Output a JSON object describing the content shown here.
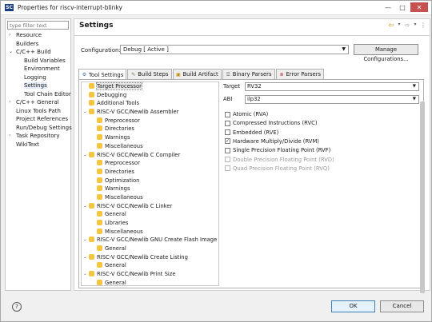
{
  "window": {
    "title": "Properties for riscv-interrupt-blinky",
    "app_icon_text": "SC"
  },
  "filter_placeholder": "type filter text",
  "nav_tree": [
    {
      "label": "Resource",
      "level": 0,
      "toggle": "›"
    },
    {
      "label": "Builders",
      "level": 0,
      "toggle": ""
    },
    {
      "label": "C/C++ Build",
      "level": 0,
      "toggle": "⌄"
    },
    {
      "label": "Build Variables",
      "level": 1,
      "toggle": ""
    },
    {
      "label": "Environment",
      "level": 1,
      "toggle": ""
    },
    {
      "label": "Logging",
      "level": 1,
      "toggle": ""
    },
    {
      "label": "Settings",
      "level": 1,
      "toggle": "",
      "selected": true
    },
    {
      "label": "Tool Chain Editor",
      "level": 1,
      "toggle": ""
    },
    {
      "label": "C/C++ General",
      "level": 0,
      "toggle": "›"
    },
    {
      "label": "Linux Tools Path",
      "level": 0,
      "toggle": ""
    },
    {
      "label": "Project References",
      "level": 0,
      "toggle": ""
    },
    {
      "label": "Run/Debug Settings",
      "level": 0,
      "toggle": ""
    },
    {
      "label": "Task Repository",
      "level": 0,
      "toggle": "›"
    },
    {
      "label": "WikiText",
      "level": 0,
      "toggle": ""
    }
  ],
  "page": {
    "title": "Settings",
    "configuration_label": "Configuration:",
    "configuration_value": "Debug  [ Active ]",
    "manage_button": "Manage Configurations..."
  },
  "tabs": [
    {
      "label": "Tool Settings",
      "active": true,
      "icon": "tool-settings-icon"
    },
    {
      "label": "Build Steps",
      "active": false,
      "icon": "build-steps-icon"
    },
    {
      "label": "Build Artifact",
      "active": false,
      "icon": "build-artifact-icon"
    },
    {
      "label": "Binary Parsers",
      "active": false,
      "icon": "binary-parsers-icon"
    },
    {
      "label": "Error Parsers",
      "active": false,
      "icon": "error-parsers-icon"
    }
  ],
  "tool_tree": [
    {
      "label": "Target Processor",
      "level": 0,
      "toggle": "",
      "selected": true
    },
    {
      "label": "Debugging",
      "level": 0,
      "toggle": ""
    },
    {
      "label": "Additional Tools",
      "level": 0,
      "toggle": ""
    },
    {
      "label": "RISC-V GCC/Newlib Assembler",
      "level": 0,
      "toggle": "⌄"
    },
    {
      "label": "Preprocessor",
      "level": 1,
      "toggle": ""
    },
    {
      "label": "Directories",
      "level": 1,
      "toggle": ""
    },
    {
      "label": "Warnings",
      "level": 1,
      "toggle": ""
    },
    {
      "label": "Miscellaneous",
      "level": 1,
      "toggle": ""
    },
    {
      "label": "RISC-V GCC/Newlib C Compiler",
      "level": 0,
      "toggle": "⌄"
    },
    {
      "label": "Preprocessor",
      "level": 1,
      "toggle": ""
    },
    {
      "label": "Directories",
      "level": 1,
      "toggle": ""
    },
    {
      "label": "Optimization",
      "level": 1,
      "toggle": ""
    },
    {
      "label": "Warnings",
      "level": 1,
      "toggle": ""
    },
    {
      "label": "Miscellaneous",
      "level": 1,
      "toggle": ""
    },
    {
      "label": "RISC-V GCC/Newlib C Linker",
      "level": 0,
      "toggle": "⌄"
    },
    {
      "label": "General",
      "level": 1,
      "toggle": ""
    },
    {
      "label": "Libraries",
      "level": 1,
      "toggle": ""
    },
    {
      "label": "Miscellaneous",
      "level": 1,
      "toggle": ""
    },
    {
      "label": "RISC-V GCC/Newlib GNU Create Flash Image",
      "level": 0,
      "toggle": "⌄"
    },
    {
      "label": "General",
      "level": 1,
      "toggle": ""
    },
    {
      "label": "RISC-V GCC/Newlib Create Listing",
      "level": 0,
      "toggle": "⌄"
    },
    {
      "label": "General",
      "level": 1,
      "toggle": ""
    },
    {
      "label": "RISC-V GCC/Newlib Print Size",
      "level": 0,
      "toggle": "⌄"
    },
    {
      "label": "General",
      "level": 1,
      "toggle": ""
    }
  ],
  "target": {
    "label": "Target",
    "value": "RV32"
  },
  "abi": {
    "label": "ABI",
    "value": "ilp32"
  },
  "extensions": [
    {
      "label": "Atomic (RVA)",
      "checked": false,
      "enabled": true
    },
    {
      "label": "Compressed Instructions (RVC)",
      "checked": false,
      "enabled": true
    },
    {
      "label": "Embedded (RVE)",
      "checked": false,
      "enabled": true
    },
    {
      "label": "Hardware Multiply/Divide (RVM)",
      "checked": true,
      "enabled": true
    },
    {
      "label": "Single Precision Floating Point (RVF)",
      "checked": false,
      "enabled": true
    },
    {
      "label": "Double Precision Floating Point (RVD)",
      "checked": false,
      "enabled": false
    },
    {
      "label": "Quad Precision Floating Point (RVQ)",
      "checked": false,
      "enabled": false
    }
  ],
  "buttons": {
    "help": "?",
    "ok": "OK",
    "cancel": "Cancel"
  },
  "colors": {
    "folder_icon": "#f5c542",
    "ok_border": "#3c7fb1",
    "close_btn": "#c75050"
  }
}
